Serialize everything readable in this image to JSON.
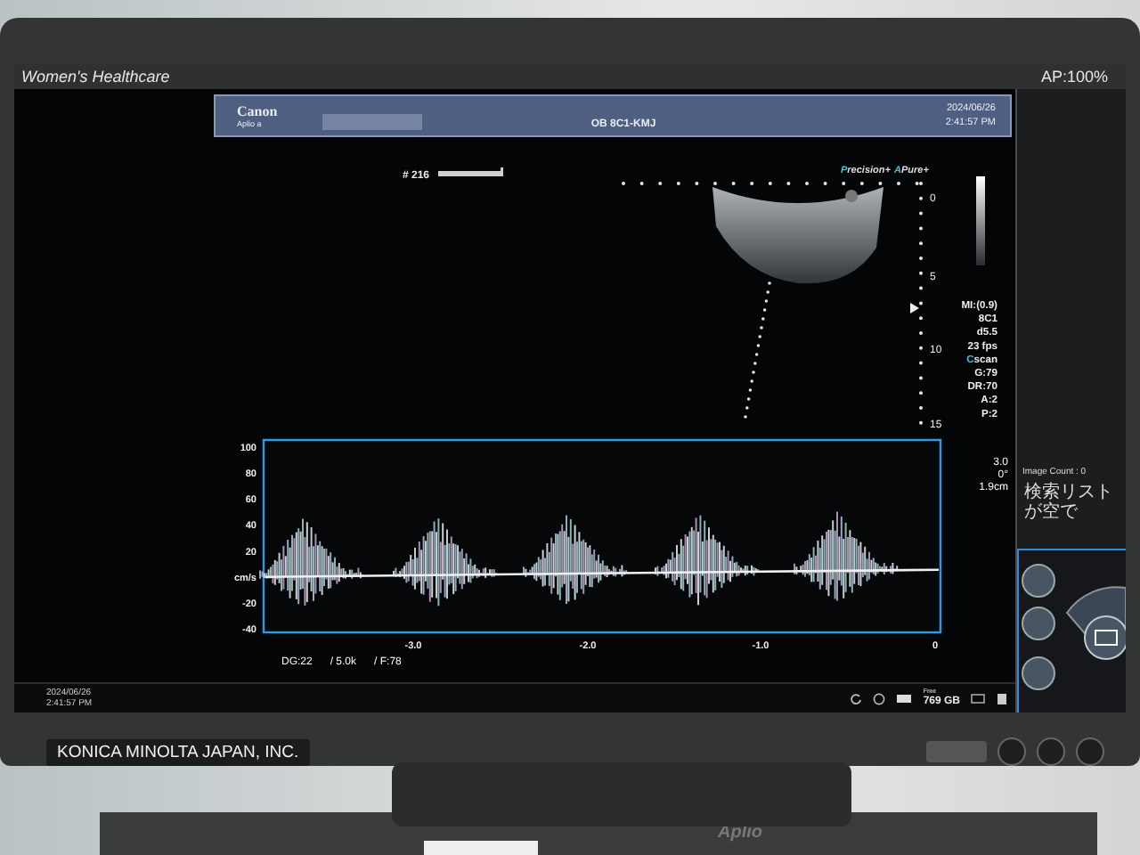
{
  "top_bar": {
    "application": "Women's Healthcare",
    "acoustic_power": "AP:100%"
  },
  "header": {
    "brand": "Canon",
    "model": "Aplio a",
    "exam": "OB 8C1-KMJ",
    "date": "2024/06/26",
    "time": "2:41:57 PM"
  },
  "image": {
    "frame_label": "# 216",
    "presets": [
      {
        "initial": "P",
        "rest": "recision+"
      },
      {
        "initial": "A",
        "rest": "Pure+"
      }
    ],
    "depth_marks": [
      "0",
      "5",
      "10",
      "15"
    ],
    "parameters": [
      {
        "text": "MI:(0.9)",
        "kind": "plain"
      },
      {
        "text": "8C1",
        "kind": "plain"
      },
      {
        "text": "d5.5",
        "kind": "plain"
      },
      {
        "text": "23 fps",
        "kind": "plain"
      },
      {
        "text": "Cscan",
        "kind": "accent"
      },
      {
        "text": "G:79",
        "kind": "plain"
      },
      {
        "text": "DR:70",
        "kind": "plain"
      },
      {
        "text": "A:2",
        "kind": "plain"
      },
      {
        "text": "P:2",
        "kind": "plain"
      }
    ]
  },
  "doppler": {
    "y_ticks": [
      "100",
      "80",
      "60",
      "40",
      "20",
      "cm/s",
      "-20",
      "-40"
    ],
    "x_ticks": [
      "-3.0",
      "-2.0",
      "-1.0",
      "0"
    ],
    "readouts": [
      "3.0",
      "0°",
      "1.9cm"
    ],
    "settings": [
      "DG:22",
      "/ 5.0k",
      "/ F:78"
    ]
  },
  "side_panel": {
    "image_count": "Image Count : 0",
    "search_message": "検索リストが空で"
  },
  "status_bar": {
    "date": "2024/06/26",
    "time": "2:41:57 PM",
    "storage_label": "Free",
    "storage": "769 GB"
  },
  "bezel": {
    "maker_label": "KONICA MINOLTA JAPAN, INC.",
    "stand_text": "Aplio"
  }
}
